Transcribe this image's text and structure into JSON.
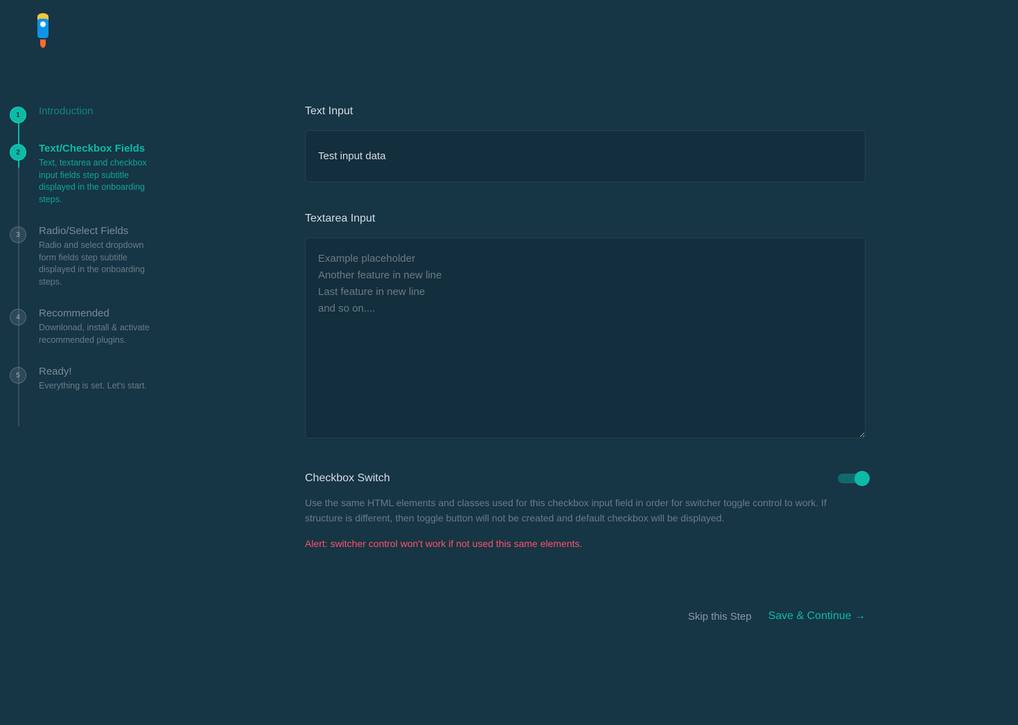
{
  "sidebar": {
    "steps": [
      {
        "num": "1",
        "title": "Introduction",
        "subtitle": ""
      },
      {
        "num": "2",
        "title": "Text/Checkbox Fields",
        "subtitle": "Text, textarea and checkbox input fields step subtitle displayed in the onboarding steps."
      },
      {
        "num": "3",
        "title": "Radio/Select Fields",
        "subtitle": "Radio and select dropdown form fields step subtitle displayed in the onboarding steps."
      },
      {
        "num": "4",
        "title": "Recommended",
        "subtitle": "Downlonad, install & activate recommended plugins."
      },
      {
        "num": "5",
        "title": "Ready!",
        "subtitle": "Everything is set. Let's start."
      }
    ]
  },
  "form": {
    "textInput": {
      "label": "Text Input",
      "value": "Test input data"
    },
    "textareaInput": {
      "label": "Textarea Input",
      "placeholder": "Example placeholder\nAnother feature in new line\nLast feature in new line\nand so on...."
    },
    "checkbox": {
      "label": "Checkbox Switch",
      "description": "Use the same HTML elements and classes used for this checkbox input field in order for switcher toggle control to work. If structure is different, then toggle button will not be created and default checkbox will be displayed.",
      "alert": "Alert: switcher control won't work if not used this same elements.",
      "checked": true
    }
  },
  "footer": {
    "skip": "Skip this Step",
    "save": "Save & Continue →"
  }
}
